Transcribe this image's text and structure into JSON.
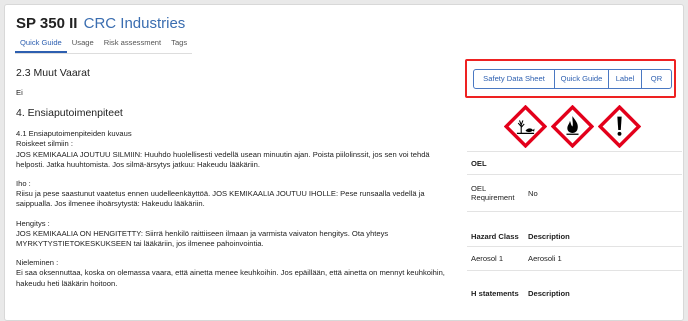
{
  "header": {
    "product": "SP 350 II",
    "company": "CRC Industries"
  },
  "tabs": [
    {
      "label": "Quick Guide"
    },
    {
      "label": "Usage"
    },
    {
      "label": "Risk assessment"
    },
    {
      "label": "Tags"
    }
  ],
  "content": {
    "section_23_title": "2.3 Muut Vaarat",
    "section_23_value": "Ei",
    "section_4_title": "4. Ensiaputoimenpiteet",
    "sub_41_title": "4.1 Ensiaputoimenpiteiden kuvaus",
    "eyes_label": "Roiskeet silmiin :",
    "eyes_text": "JOS KEMIKAALIA JOUTUU SILMIIN: Huuhdo huolellisesti vedellä usean minuutin ajan. Poista piilolinssit, jos sen voi tehdä helposti. Jatka huuhtomista. Jos silmä-ärsytys jatkuu: Hakeudu lääkäriin.",
    "skin_label": "Iho :",
    "skin_text": "Riisu ja pese saastunut vaatetus ennen uudelleenkäyttöä. JOS KEMIKAALIA JOUTUU IHOLLE: Pese runsaalla vedellä ja saippualla. Jos ilmenee ihoärsytystä: Hakeudu lääkäriin.",
    "inhal_label": "Hengitys :",
    "inhal_text": "JOS KEMIKAALIA ON HENGITETTY: Siirrä henkilö raittiiseen ilmaan ja varmista vaivaton hengitys. Ota yhteys MYRKYTYSTIETOKESKUKSEEN tai lääkäriin, jos ilmenee pahoinvointia.",
    "ingest_label": "Nieleminen :",
    "ingest_text": "Ei saa oksennuttaa, koska on olemassa vaara, että ainetta menee keuhkoihin. Jos epäillään, että ainetta on mennyt keuhkoihin, hakeudu heti lääkärin hoitoon."
  },
  "doc_buttons": [
    {
      "label": "Safety Data Sheet"
    },
    {
      "label": "Quick Guide"
    },
    {
      "label": "Label"
    },
    {
      "label": "QR"
    }
  ],
  "pictograms": [
    "environment-hazard-icon",
    "flammable-icon",
    "exclamation-mark-icon"
  ],
  "colors": {
    "ghs_red": "#e3001b",
    "accent": "#2d5fb0",
    "highlight_border": "#e22222"
  },
  "oel": {
    "heading": "OEL",
    "label": "OEL Requirement",
    "value": "No"
  },
  "hazard": {
    "col1": "Hazard Class",
    "col2": "Description",
    "rows": [
      {
        "class": "Aerosol 1",
        "description": "Aerosoli 1"
      }
    ]
  },
  "hstatements": {
    "col1": "H statements",
    "col2": "Description"
  }
}
